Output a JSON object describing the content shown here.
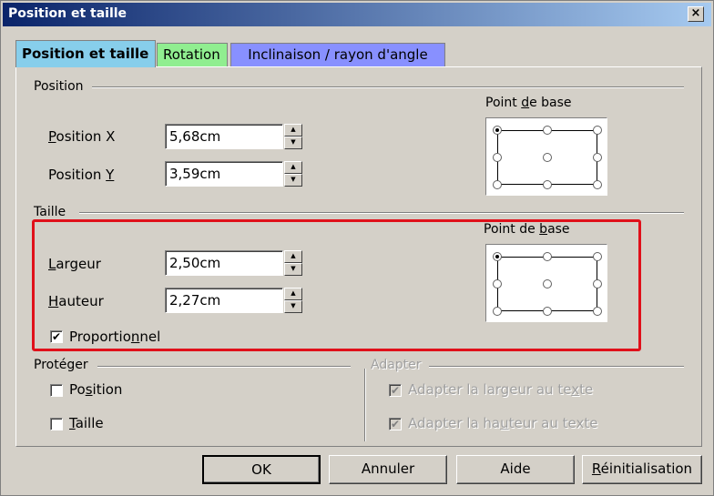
{
  "window": {
    "title": "Position et taille",
    "close_glyph": "×"
  },
  "tabs": [
    {
      "label": "Position et taille",
      "active": true
    },
    {
      "label": "Rotation"
    },
    {
      "label": "Inclinaison / rayon d'angle"
    }
  ],
  "position_group": {
    "title": "Position",
    "x_label_pre": "",
    "x_label_u": "P",
    "x_label_post": "osition X",
    "y_label_pre": "Position ",
    "y_label_u": "Y",
    "y_label_post": "",
    "x_value": "5,68cm",
    "y_value": "3,59cm",
    "base_point_pre": "Point ",
    "base_point_u": "d",
    "base_point_post": "e base"
  },
  "size_group": {
    "title": "Taille",
    "width_pre": "",
    "width_u": "L",
    "width_post": "argeur",
    "height_pre": "",
    "height_u": "H",
    "height_post": "auteur",
    "width_value": "2,50cm",
    "height_value": "2,27cm",
    "keep_ratio_pre": "Proportio",
    "keep_ratio_u": "n",
    "keep_ratio_post": "nel",
    "keep_ratio_checked": true,
    "base_point_pre": "Point de ",
    "base_point_u": "b",
    "base_point_post": "ase"
  },
  "protect_group": {
    "title": "Protéger",
    "position_pre": "Po",
    "position_u": "s",
    "position_post": "ition",
    "size_pre": "",
    "size_u": "T",
    "size_post": "aille",
    "check_mark": "✔"
  },
  "adapt_group": {
    "title": "Adapter",
    "fit_width_pre": "Adapter la largeur au te",
    "fit_width_u": "x",
    "fit_width_post": "te",
    "fit_height_pre": "Adapter la ha",
    "fit_height_u": "u",
    "fit_height_post": "teur au texte"
  },
  "buttons": {
    "ok": "OK",
    "cancel": "Annuler",
    "help": "Aide",
    "reset_u": "R",
    "reset_post": "éinitialisation"
  },
  "spin_up": "▲",
  "spin_down": "▼",
  "colors": {
    "highlight_box": "#e0101a",
    "tab_active": "#87ceeb",
    "tab_rotation": "#90ee90",
    "tab_slant": "#8890ff"
  }
}
